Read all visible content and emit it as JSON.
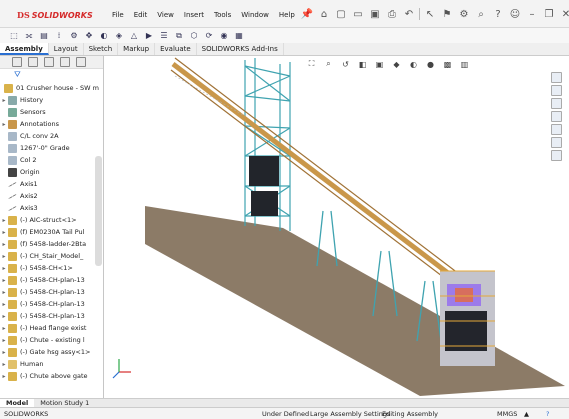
{
  "app": {
    "logo_ds": "DS",
    "logo_name": "SOLIDWORKS",
    "brand_color": "#d52b2b"
  },
  "menu": [
    "File",
    "Edit",
    "View",
    "Insert",
    "Tools",
    "Window",
    "Help"
  ],
  "command_tabs": [
    "Assembly",
    "Layout",
    "Sketch",
    "Markup",
    "Evaluate",
    "SOLIDWORKS Add-Ins"
  ],
  "active_command_tab": "Assembly",
  "feature_tree": {
    "root": "01 Crusher house - SW m",
    "items": [
      {
        "label": "History",
        "icon": "history-icon",
        "expand": true
      },
      {
        "label": "Sensors",
        "icon": "sensor-icon",
        "expand": false
      },
      {
        "label": "Annotations",
        "icon": "annotation-icon",
        "expand": true
      },
      {
        "label": "C/L conv 2A",
        "icon": "plane-icon",
        "expand": false
      },
      {
        "label": "1267'-0\" Grade",
        "icon": "plane-icon",
        "expand": false
      },
      {
        "label": "Col 2",
        "icon": "plane-icon",
        "expand": false
      },
      {
        "label": "Origin",
        "icon": "origin-icon",
        "expand": false
      },
      {
        "label": "Axis1",
        "icon": "axis-icon",
        "expand": false
      },
      {
        "label": "Axis2",
        "icon": "axis-icon",
        "expand": false
      },
      {
        "label": "Axis3",
        "icon": "axis-icon",
        "expand": false
      },
      {
        "label": "(-) AIC-struct<1>",
        "icon": "assembly-icon",
        "expand": true
      },
      {
        "label": "(f) EM0230A Tail Pul",
        "icon": "assembly-icon",
        "expand": true
      },
      {
        "label": "(f) 5458-ladder-2Bta",
        "icon": "assembly-icon",
        "expand": true
      },
      {
        "label": "(-) CH_Stair_Model_",
        "icon": "assembly-icon",
        "expand": true
      },
      {
        "label": "(-) 5458-CH<1>",
        "icon": "assembly-icon",
        "expand": true
      },
      {
        "label": "(-) 5458-CH-plan-13",
        "icon": "assembly-icon",
        "expand": true
      },
      {
        "label": "(-) 5458-CH-plan-13",
        "icon": "assembly-icon",
        "expand": true
      },
      {
        "label": "(-) 5458-CH-plan-13",
        "icon": "assembly-icon",
        "expand": true
      },
      {
        "label": "(-) 5458-CH-plan-13",
        "icon": "assembly-icon",
        "expand": true
      },
      {
        "label": "(-) Head flange exist",
        "icon": "assembly-icon",
        "expand": true
      },
      {
        "label": "(-) Chute - existing l",
        "icon": "assembly-icon",
        "expand": true
      },
      {
        "label": "(-) Gate hsg assy<1>",
        "icon": "assembly-icon",
        "expand": true
      },
      {
        "label": "Human",
        "icon": "folder-icon",
        "expand": true
      },
      {
        "label": "(-) Chute above gate",
        "icon": "assembly-icon",
        "expand": true
      }
    ]
  },
  "bottom_tabs": [
    "Model",
    "Motion Study 1"
  ],
  "active_bottom_tab": "Model",
  "status": {
    "app": "SOLIDWORKS",
    "definition": "Under Defined",
    "large_assembly": "Large Assembly Settings",
    "editing": "Editing Assembly",
    "units": "MMGS",
    "units_arrow": "▲",
    "help": "?"
  },
  "colors": {
    "structure": "#3fa3b0",
    "conveyor": "#c9974a",
    "ground": "#8c7b67",
    "accent": "#2a6fd1"
  }
}
